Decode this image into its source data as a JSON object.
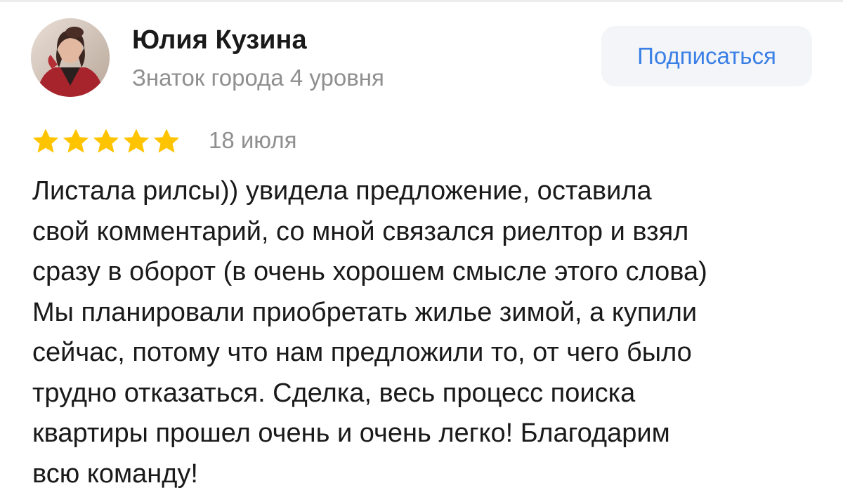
{
  "author": {
    "name": "Юлия Кузина",
    "level": "Знаток города 4 уровня"
  },
  "actions": {
    "subscribe_label": "Подписаться"
  },
  "review": {
    "rating": 5,
    "rating_max": 5,
    "date": "18 июля",
    "lines": [
      "Листала рилсы)) увидела предложение, оставила",
      "свой комментарий, со мной связался риелтор и взял",
      "сразу в оборот (в очень хорошем смысле этого слова)",
      "Мы планировали приобретать жилье зимой, а купили",
      "сейчас, потому что нам предложили то, от чего было",
      "трудно отказаться. Сделка, весь процесс поиска",
      "квартиры прошел очень и очень легко! Благодарим",
      "всю команду!"
    ]
  },
  "icons": {
    "star": "star-icon",
    "avatar": "user-avatar"
  },
  "colors": {
    "star": "#ffc400",
    "accent": "#3a7fe6",
    "button_bg": "#f3f5f8",
    "muted_text": "#8f8f8f",
    "text": "#1a1a1a"
  }
}
